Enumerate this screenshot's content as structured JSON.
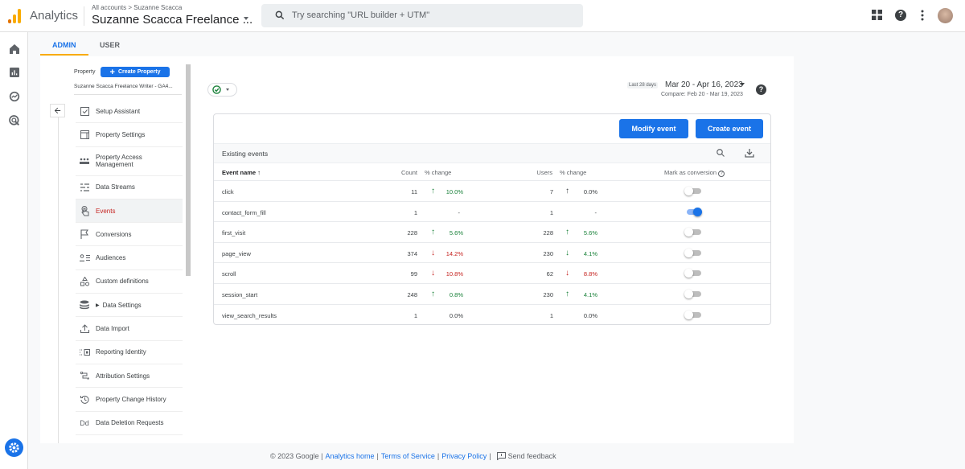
{
  "header": {
    "app_name": "Analytics",
    "breadcrumb": "All accounts > Suzanne Scacca",
    "account_name": "Suzanne Scacca Freelance ...",
    "search_placeholder": "Try searching \"URL builder + UTM\"",
    "icons": [
      "apps-grid-icon",
      "help-icon",
      "more-vert-icon",
      "avatar"
    ]
  },
  "left_rail": {
    "icons": [
      "home-icon",
      "reports-icon",
      "explore-icon",
      "advertising-icon",
      "admin-gear-icon"
    ]
  },
  "tabs": [
    {
      "label": "ADMIN",
      "active": true
    },
    {
      "label": "USER",
      "active": false
    }
  ],
  "property": {
    "label": "Property",
    "create_button": "Create Property",
    "name": "Suzanne Scacca Freelance Writer - GA4..."
  },
  "nav": [
    {
      "label": "Setup Assistant",
      "icon": "checklist-icon"
    },
    {
      "label": "Property Settings",
      "icon": "property-settings-icon"
    },
    {
      "label": "Property Access Management",
      "icon": "people-icon"
    },
    {
      "label": "Data Streams",
      "icon": "data-streams-icon"
    },
    {
      "label": "Events",
      "icon": "touch-icon",
      "active": true
    },
    {
      "label": "Conversions",
      "icon": "flag-icon"
    },
    {
      "label": "Audiences",
      "icon": "audience-icon"
    },
    {
      "label": "Custom definitions",
      "icon": "custom-definitions-icon"
    },
    {
      "label": "Data Settings",
      "icon": "database-icon",
      "expandable": true
    },
    {
      "label": "Data Import",
      "icon": "upload-icon"
    },
    {
      "label": "Reporting Identity",
      "icon": "reporting-identity-icon"
    },
    {
      "label": "Attribution Settings",
      "icon": "attribution-icon"
    },
    {
      "label": "Property Change History",
      "icon": "history-icon"
    },
    {
      "label": "Data Deletion Requests",
      "icon": "data-deletion-icon",
      "glyph": "Dd"
    }
  ],
  "date": {
    "badge": "Last 28 days",
    "range": "Mar 20 - Apr 16, 2023",
    "compare": "Compare: Feb 20 - Mar 19, 2023"
  },
  "events_card": {
    "modify_button": "Modify event",
    "create_button": "Create event",
    "title": "Existing events",
    "columns": {
      "event_name": "Event name",
      "count": "Count",
      "count_change": "% change",
      "users": "Users",
      "users_change": "% change",
      "conversion": "Mark as conversion"
    },
    "rows": [
      {
        "name": "click",
        "count": "11",
        "count_dir": "up",
        "count_change": "10.0%",
        "count_color": "green",
        "users": "7",
        "users_dir": "up-neutral",
        "users_change": "0.0%",
        "users_color": "neutral",
        "conversion": false
      },
      {
        "name": "contact_form_fill",
        "count": "1",
        "count_dir": "none",
        "count_change": "-",
        "count_color": "neutral",
        "users": "1",
        "users_dir": "none",
        "users_change": "-",
        "users_color": "neutral",
        "conversion": true
      },
      {
        "name": "first_visit",
        "count": "228",
        "count_dir": "up",
        "count_change": "5.6%",
        "count_color": "green",
        "users": "228",
        "users_dir": "up",
        "users_change": "5.6%",
        "users_color": "green",
        "conversion": false
      },
      {
        "name": "page_view",
        "count": "374",
        "count_dir": "down-red",
        "count_change": "14.2%",
        "count_color": "red",
        "users": "230",
        "users_dir": "down-green",
        "users_change": "4.1%",
        "users_color": "green",
        "conversion": false
      },
      {
        "name": "scroll",
        "count": "99",
        "count_dir": "down-red",
        "count_change": "10.8%",
        "count_color": "red",
        "users": "62",
        "users_dir": "down-red",
        "users_change": "8.8%",
        "users_color": "red",
        "conversion": false
      },
      {
        "name": "session_start",
        "count": "248",
        "count_dir": "up",
        "count_change": "0.8%",
        "count_color": "green",
        "users": "230",
        "users_dir": "up",
        "users_change": "4.1%",
        "users_color": "green",
        "conversion": false
      },
      {
        "name": "view_search_results",
        "count": "1",
        "count_dir": "none",
        "count_change": "0.0%",
        "count_color": "neutral",
        "users": "1",
        "users_dir": "none",
        "users_change": "0.0%",
        "users_color": "neutral",
        "conversion": false
      }
    ]
  },
  "footer": {
    "copyright": "© 2023 Google |",
    "analytics_home": "Analytics home",
    "sep1": "|",
    "terms": "Terms of Service",
    "sep2": "|",
    "privacy": "Privacy Policy",
    "sep3": "|",
    "feedback": "Send feedback"
  },
  "colors": {
    "accent": "#1a73e8",
    "tab_indicator": "#f9ab00",
    "positive": "#188038",
    "negative": "#c5221f"
  }
}
